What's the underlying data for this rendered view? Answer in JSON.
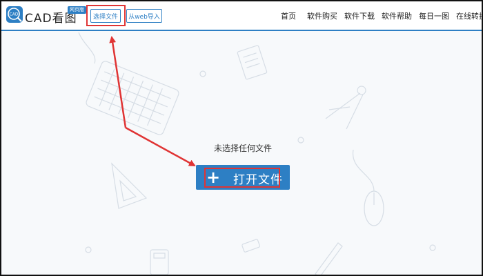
{
  "header": {
    "logo_text": "CAD",
    "app_title": "CAD看图",
    "web_badge": "网页版",
    "select_file_label": "选择文件",
    "web_import_label": "从web导入"
  },
  "nav": {
    "items": [
      {
        "label": "首页"
      },
      {
        "label": "软件购买"
      },
      {
        "label": "软件下载"
      },
      {
        "label": "软件帮助"
      },
      {
        "label": "每日一图"
      },
      {
        "label": "在线转换"
      }
    ]
  },
  "main": {
    "empty_text": "未选择任何文件",
    "open_button_label": "打开文件",
    "open_button_icon": "plus-icon"
  },
  "colors": {
    "accent": "#2d7fc4",
    "annotation_red": "#e03434"
  }
}
